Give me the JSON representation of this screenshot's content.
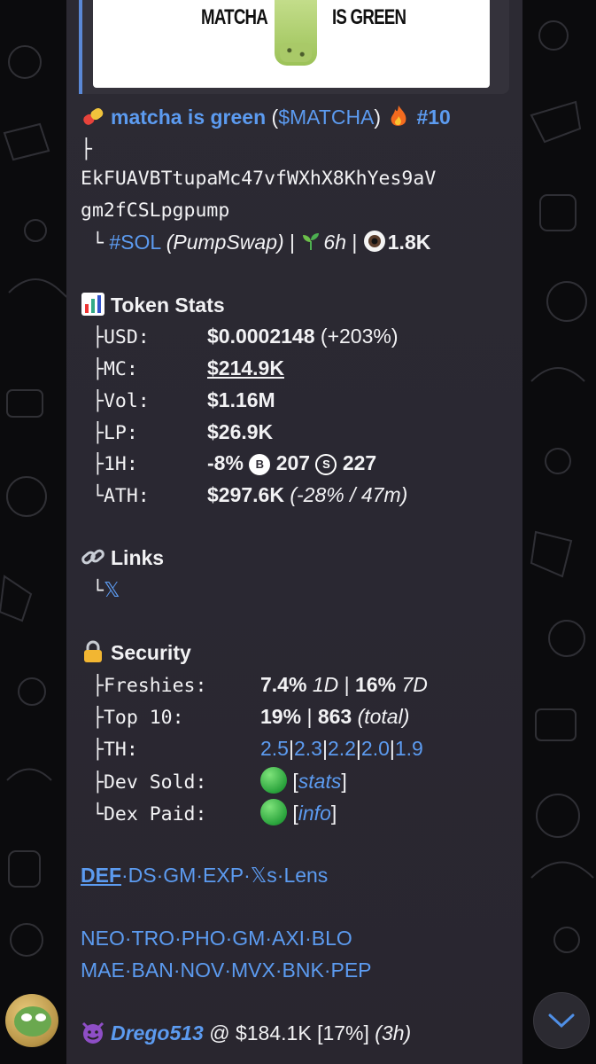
{
  "preview": {
    "left_text": "MATCHA",
    "right_text": "IS GREEN"
  },
  "token": {
    "name": "matcha is green",
    "ticker_open": "(",
    "ticker": "$MATCHA",
    "ticker_close": ")",
    "rank": "#10",
    "address_line1": "EkFUAVBTtupaMc47vfWXhX8KhYes9aV",
    "address_line2": "gm2fCSLpgpump",
    "chain": "#SOL",
    "dex": "(PumpSwap)",
    "age": "6h",
    "views": "1.8K",
    "tree_top": "├",
    "tree_end": "└"
  },
  "stats": {
    "header": "Token Stats",
    "rows": [
      {
        "prefix": "├",
        "label": "USD:",
        "value": "$0.0002148",
        "extra": "(+203%)"
      },
      {
        "prefix": "├",
        "label": "MC:",
        "value": "$214.9K"
      },
      {
        "prefix": "├",
        "label": "Vol:",
        "value": "$1.16M"
      },
      {
        "prefix": "├",
        "label": "LP:",
        "value": "$26.9K"
      },
      {
        "prefix": "├",
        "label": "1H:",
        "value": "-8%",
        "buys": "207",
        "sells": "227"
      },
      {
        "prefix": "└",
        "label": "ATH:",
        "value": "$297.6K",
        "extra": "(-28% / 47m)"
      }
    ],
    "buy_icon": "B",
    "sell_icon": "S"
  },
  "links": {
    "header": "Links",
    "prefix": "└",
    "x_label": "𝕏"
  },
  "security": {
    "header": "Security",
    "freshies_label": "├Freshies:",
    "freshies_1d": "7.4%",
    "freshies_1d_unit": "1D",
    "freshies_7d": "16%",
    "freshies_7d_unit": "7D",
    "top10_label": "├Top 10:",
    "top10_pct": "19%",
    "top10_count": "863",
    "top10_unit": "(total)",
    "th_label": "├TH:",
    "th_values": [
      "2.5",
      "2.3",
      "2.2",
      "2.0",
      "1.9"
    ],
    "dev_label": "├Dev Sold:",
    "dev_link": "stats",
    "dex_label": "└Dex Paid:",
    "dex_link": "info",
    "sep": "|"
  },
  "bots_row1": [
    "DEF",
    "DS",
    "GM",
    "EXP",
    "𝕏s",
    "Lens"
  ],
  "bots_row2": [
    "NEO",
    "TRO",
    "PHO",
    "GM",
    "AXI",
    "BLO"
  ],
  "bots_row3": [
    "MAE",
    "BAN",
    "NOV",
    "MVX",
    "BNK",
    "PEP"
  ],
  "caller": {
    "name": "Drego513",
    "at": "@",
    "mc": "$184.1K",
    "pct": "[17%]",
    "time": "(3h)"
  },
  "colors": {
    "link": "#5c9bf0",
    "bubble": "#2b2932",
    "accent_bar": "#5a88d6"
  }
}
